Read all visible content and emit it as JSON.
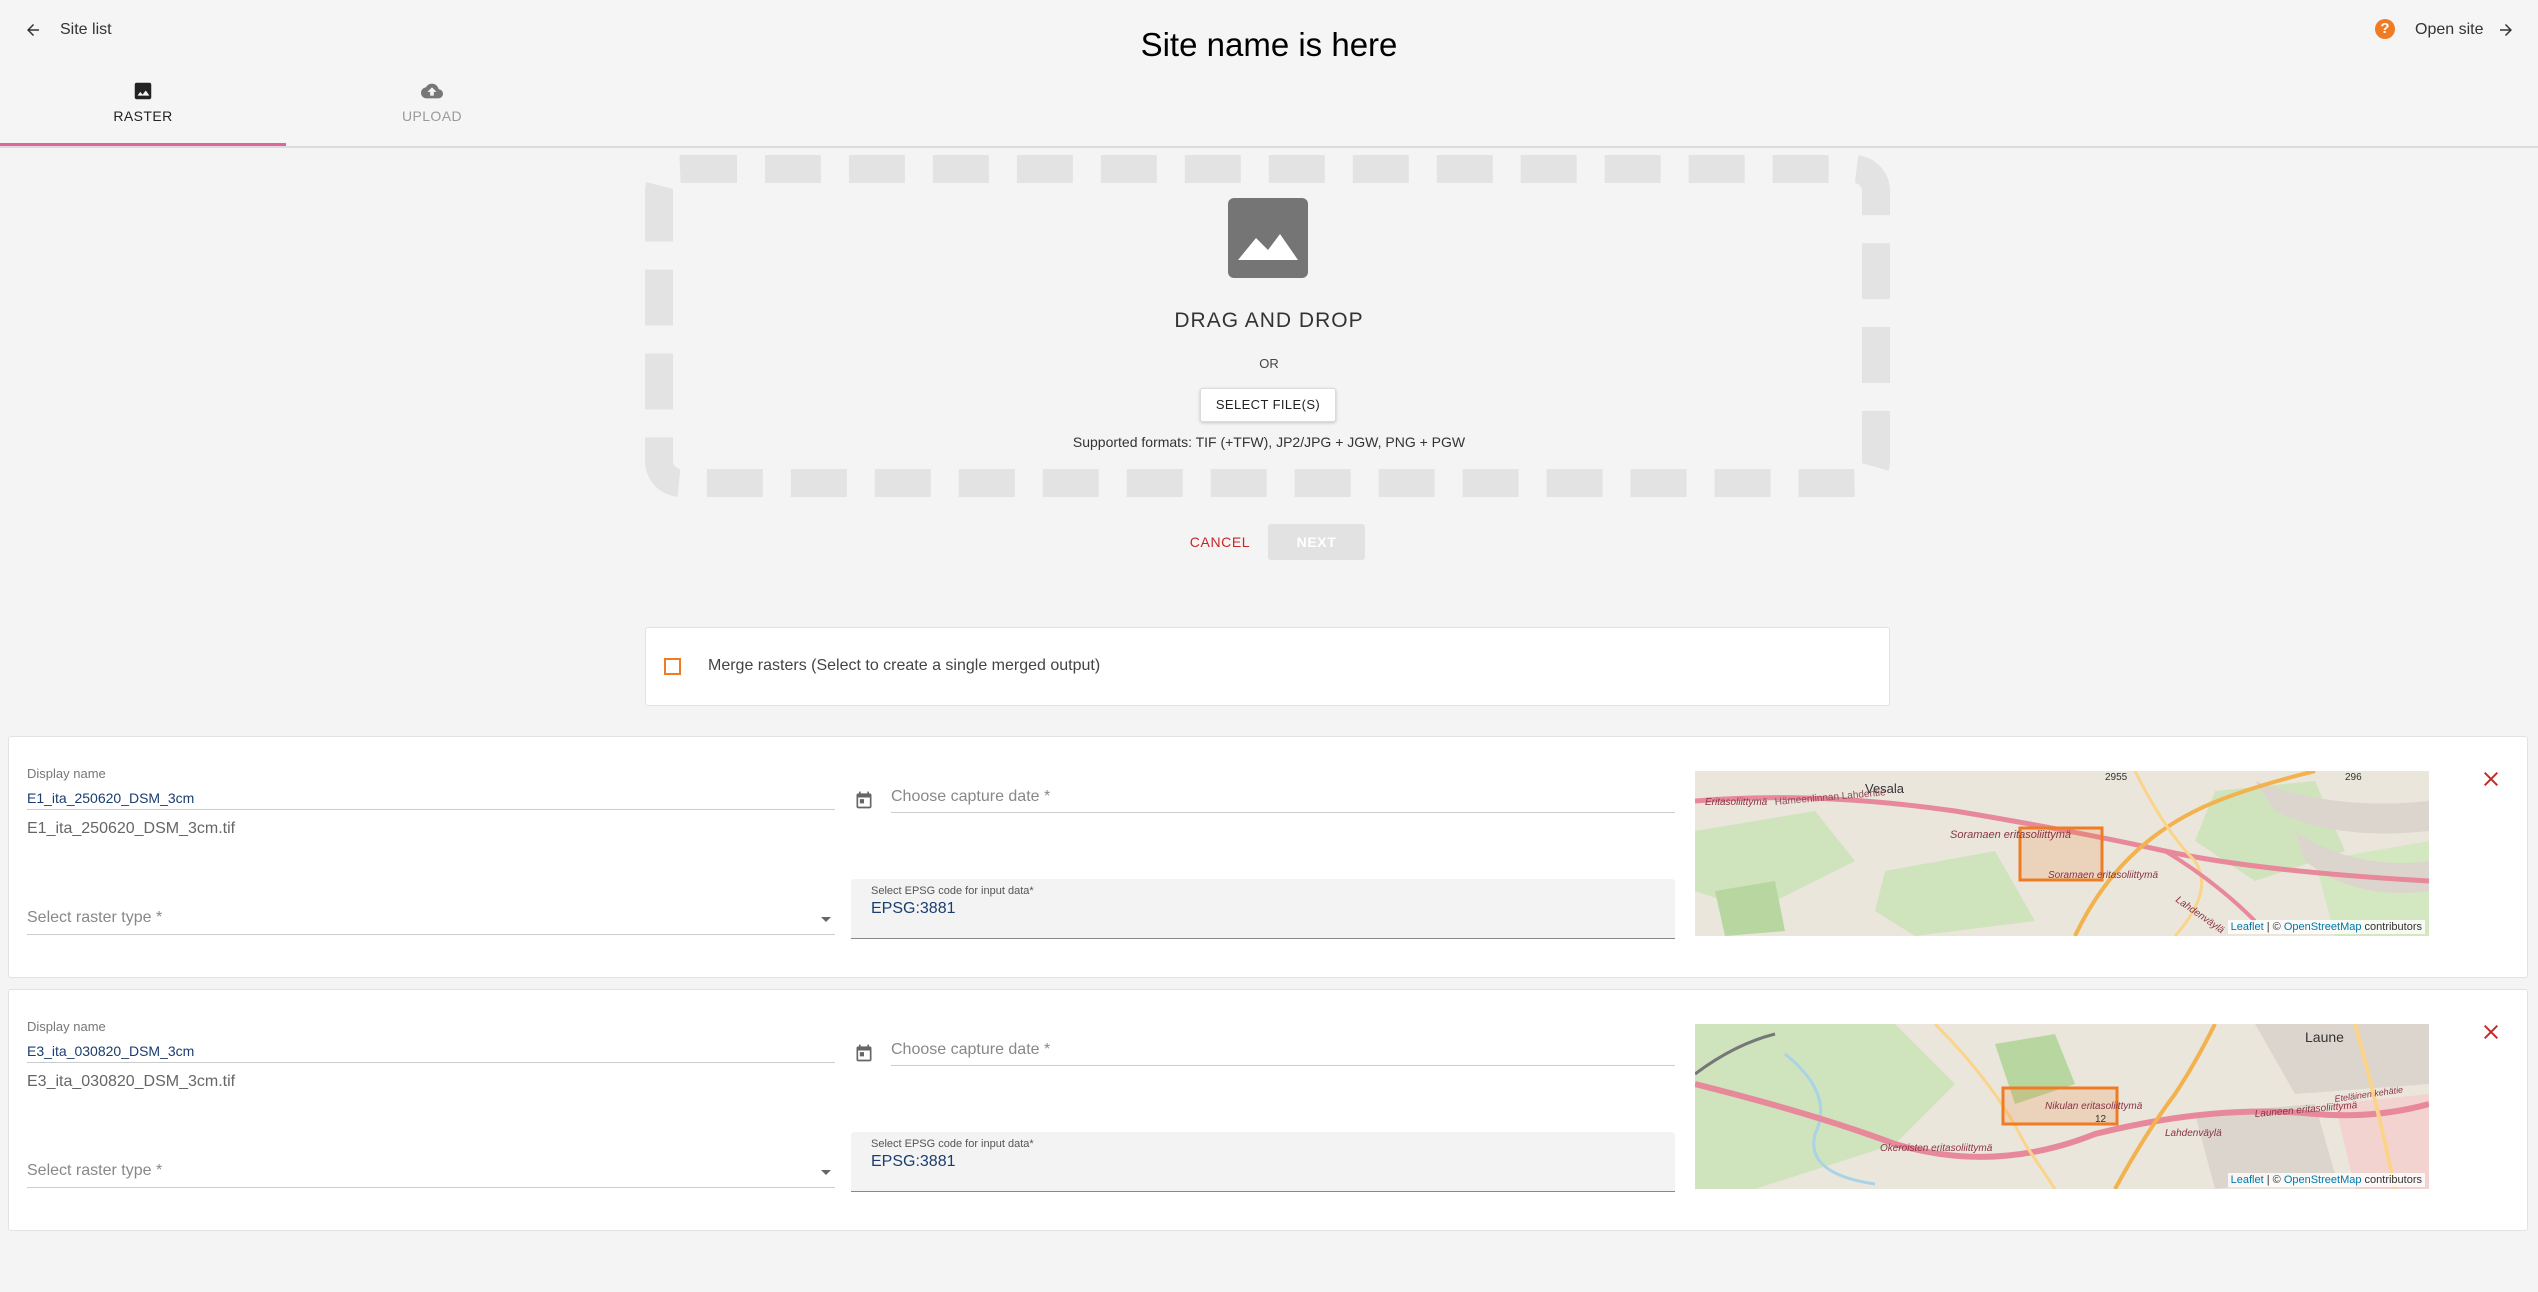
{
  "header": {
    "back_label": "Site list",
    "title": "Site name is here",
    "help_glyph": "?",
    "open_label": "Open site",
    "help_color": "#ef7c25"
  },
  "tabs": [
    {
      "label": "RASTER",
      "icon": "image-icon",
      "active": true
    },
    {
      "label": "UPLOAD",
      "icon": "cloud-upload-icon",
      "active": false
    }
  ],
  "dropzone": {
    "title": "DRAG AND DROP",
    "or": "OR",
    "select_label": "SELECT FILE(S)",
    "formats": "Supported formats: TIF (+TFW), JP2/JPG + JGW, PNG + PGW"
  },
  "actions": {
    "cancel_label": "CANCEL",
    "next_label": "NEXT"
  },
  "merge": {
    "label": "Merge rasters (Select to create a single merged output)",
    "checked": false
  },
  "rasters": [
    {
      "display_name_label": "Display name",
      "display_name": "E1_ita_250620_DSM_3cm",
      "filename": "E1_ita_250620_DSM_3cm.tif",
      "capture_date_placeholder": "Choose capture date *",
      "raster_type_placeholder": "Select raster type *",
      "epsg_label": "Select EPSG code for input data*",
      "epsg_value": "EPSG:3881",
      "map": {
        "labels": [
          "Vesala",
          "Hämeenlinnan Lahdentie",
          "Soramaen eritasoliittymä",
          "Soramaen eritasoliittymä",
          "Eritasoliittymä",
          "2955",
          "296",
          "Lahdenväylä"
        ],
        "attribution_leaflet": "Leaflet",
        "attribution_mid": " | © ",
        "attribution_osm": "OpenStreetMap",
        "attribution_end": " contributors"
      }
    },
    {
      "display_name_label": "Display name",
      "display_name": "E3_ita_030820_DSM_3cm",
      "filename": "E3_ita_030820_DSM_3cm.tif",
      "capture_date_placeholder": "Choose capture date *",
      "raster_type_placeholder": "Select raster type *",
      "epsg_label": "Select EPSG code for input data*",
      "epsg_value": "EPSG:3881",
      "map": {
        "labels": [
          "Laune",
          "Nikulan eritasoliittymä",
          "Launeen eritasoliittymä",
          "Okeroisten eritasoliittymä",
          "Lahdenväylä",
          "Eteläinen kehätie",
          "12"
        ],
        "attribution_leaflet": "Leaflet",
        "attribution_mid": " | © ",
        "attribution_osm": "OpenStreetMap",
        "attribution_end": " contributors"
      }
    }
  ]
}
